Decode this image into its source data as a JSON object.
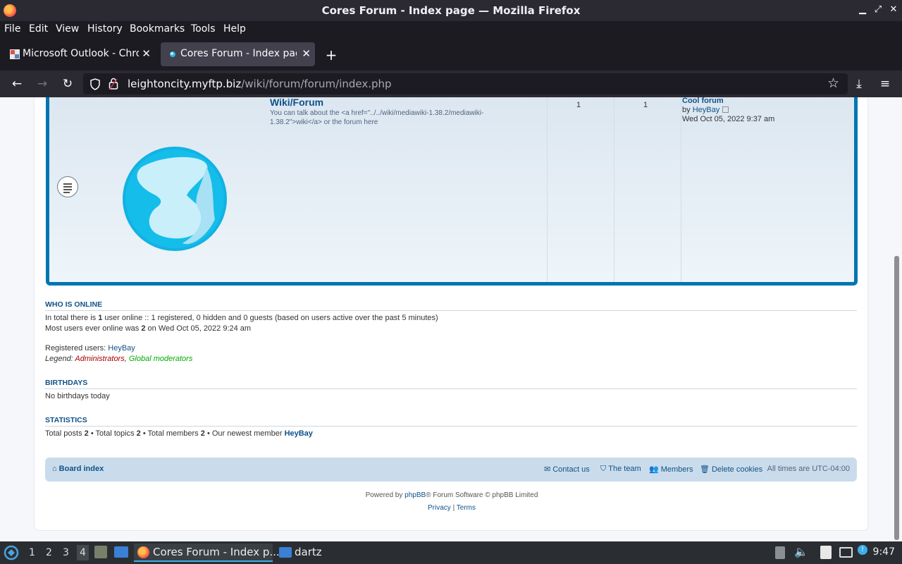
{
  "window": {
    "title": "Cores Forum - Index page — Mozilla Firefox"
  },
  "menubar": {
    "items": [
      "File",
      "Edit",
      "View",
      "History",
      "Bookmarks",
      "Tools",
      "Help"
    ]
  },
  "tabs": [
    {
      "label": "Microsoft Outlook - Chrome"
    },
    {
      "label": "Cores Forum - Index page"
    }
  ],
  "navbar": {
    "url_host": "leightoncity.myftp.biz",
    "url_path": "/wiki/forum/forum/index.php"
  },
  "forum_row": {
    "title": "Wiki/Forum",
    "description": "You can talk about the <a href=\"../../wiki/mediawiki-1.38.2/mediawiki-1.38.2\">wiki</a> or the forum here",
    "topics": "1",
    "posts": "1",
    "last_post": {
      "title": "Cool forum",
      "by_prefix": "by",
      "user": "HeyBay",
      "date": "Wed Oct 05, 2022 9:37 am"
    }
  },
  "who_is_online": {
    "heading": "WHO IS ONLINE",
    "line1_pre": "In total there is",
    "line1_count": "1",
    "line1_post": "user online :: 1 registered, 0 hidden and 0 guests (based on users active over the past 5 minutes)",
    "line2_pre": "Most users ever online was",
    "line2_count": "2",
    "line2_post": "on Wed Oct 05, 2022 9:24 am",
    "registered_label": "Registered users:",
    "registered_user": "HeyBay",
    "legend_label": "Legend:",
    "legend_admin": "Administrators",
    "legend_sep": ",",
    "legend_gmod": "Global moderators"
  },
  "birthdays": {
    "heading": "BIRTHDAYS",
    "text": "No birthdays today"
  },
  "statistics": {
    "heading": "STATISTICS",
    "posts_label": "Total posts",
    "posts": "2",
    "topics_label": "• Total topics",
    "topics": "2",
    "members_label": "• Total members",
    "members": "2",
    "newest_label": "• Our newest member",
    "newest": "HeyBay"
  },
  "footer_nav": {
    "board_index": "Board index",
    "contact": "Contact us",
    "team": "The team",
    "members": "Members",
    "delete_cookies": "Delete cookies",
    "timezone": "All times are UTC-04:00"
  },
  "powered": {
    "pre": "Powered by",
    "link": "phpBB",
    "post": "® Forum Software © phpBB Limited"
  },
  "footer_links": {
    "privacy": "Privacy",
    "sep": "|",
    "terms": "Terms"
  },
  "taskbar": {
    "workspaces": [
      "1",
      "2",
      "3",
      "4"
    ],
    "windows": [
      "Cores Forum - Index p...",
      "dartz"
    ],
    "clock": "9:47"
  },
  "colors": {
    "forum_border": "#0076b1",
    "link": "#105289",
    "admin": "#aa0000",
    "gmod": "#00aa00"
  }
}
